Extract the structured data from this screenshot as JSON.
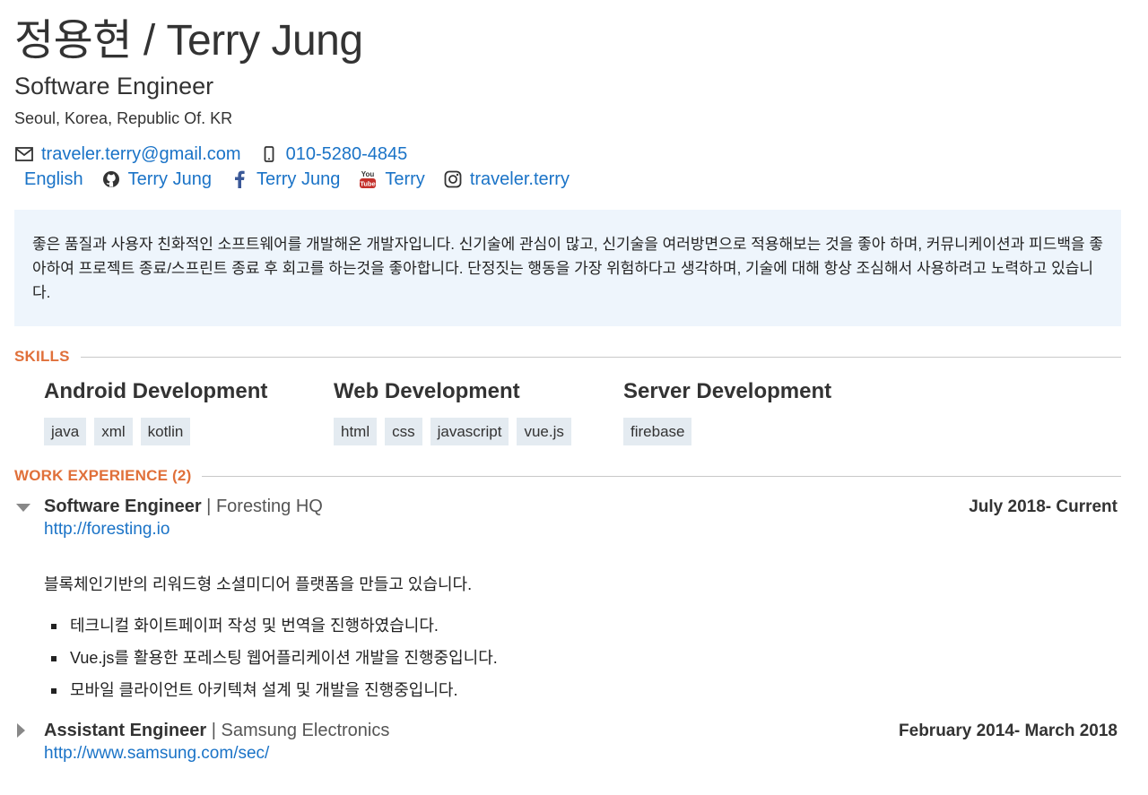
{
  "header": {
    "name": "정용현 / Terry Jung",
    "role": "Software Engineer",
    "location": "Seoul, Korea, Republic Of. KR"
  },
  "contacts": {
    "email": "traveler.terry@gmail.com",
    "phone": "010-5280-4845",
    "language": "English",
    "github": "Terry Jung",
    "facebook": "Terry Jung",
    "youtube": "Terry",
    "youtube_logo": "You Tube",
    "instagram": "traveler.terry"
  },
  "summary": "좋은 품질과 사용자 친화적인 소프트웨어를 개발해온 개발자입니다. 신기술에 관심이 많고, 신기술을 여러방면으로 적용해보는 것을 좋아 하며, 커뮤니케이션과 피드백을 좋아하여 프로젝트 종료/스프린트 종료 후 회고를 하는것을 좋아합니다. 단정짓는 행동을 가장 위험하다고 생각하며, 기술에 대해 항상 조심해서 사용하려고 노력하고 있습니다.",
  "skills": {
    "heading": "SKILLS",
    "groups": [
      {
        "title": "Android Development",
        "tags": [
          "java",
          "xml",
          "kotlin"
        ]
      },
      {
        "title": "Web Development",
        "tags": [
          "html",
          "css",
          "javascript",
          "vue.js"
        ]
      },
      {
        "title": "Server Development",
        "tags": [
          "firebase"
        ]
      }
    ]
  },
  "work": {
    "heading": "WORK EXPERIENCE (2)",
    "jobs": [
      {
        "title": "Software Engineer",
        "separator": "|",
        "company": "Foresting HQ",
        "date": "July 2018- Current",
        "link": "http://foresting.io",
        "description": "블록체인기반의 리워드형 소셜미디어 플랫폼을 만들고 있습니다.",
        "bullets": [
          "테크니컬 화이트페이퍼 작성 및 번역을 진행하였습니다.",
          "Vue.js를 활용한 포레스팅 웹어플리케이션 개발을 진행중입니다.",
          "모바일 클라이언트 아키텍쳐 설계 및 개발을 진행중입니다."
        ]
      },
      {
        "title": "Assistant Engineer",
        "separator": "|",
        "company": "Samsung Electronics",
        "date": "February 2014- March 2018",
        "link": "http://www.samsung.com/sec/"
      }
    ]
  },
  "colors": {
    "accent": "#e0703a",
    "link": "#1a73c7",
    "summary_bg": "#eef5fc",
    "tag_bg": "#e4ebf1"
  }
}
